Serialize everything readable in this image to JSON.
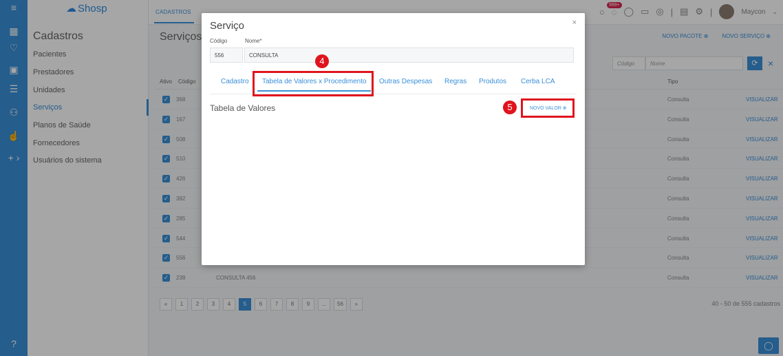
{
  "brand": {
    "name": "Shosp"
  },
  "rail_icons": [
    "menu-icon",
    "calendar-icon",
    "heart-icon",
    "camera-icon",
    "database-icon",
    "users-icon",
    "hand-icon",
    "plus-icon"
  ],
  "sidebar": {
    "title": "Cadastros",
    "items": [
      {
        "label": "Pacientes"
      },
      {
        "label": "Prestadores"
      },
      {
        "label": "Unidades"
      },
      {
        "label": "Serviços"
      },
      {
        "label": "Planos de Saúde"
      },
      {
        "label": "Fornecedores"
      },
      {
        "label": "Usuários do sistema"
      }
    ]
  },
  "header": {
    "breadcrumb": "CADASTROS",
    "notifications": "999+",
    "user": "Maycon"
  },
  "page": {
    "title": "Serviços",
    "new_package": "NOVO PACOTE ⊕",
    "new_service": "NOVO SERVIÇO ⊕",
    "filter_code_placeholder": "Código",
    "filter_name_placeholder": "Nome"
  },
  "table": {
    "headers": {
      "active": "Ativo",
      "code": "Código",
      "type": "Tipo"
    },
    "rows": [
      {
        "code": "368",
        "name": "",
        "type": "Consulta",
        "action": "VISUALIZAR"
      },
      {
        "code": "167",
        "name": "",
        "type": "Consulta",
        "action": "VISUALIZAR"
      },
      {
        "code": "508",
        "name": "",
        "type": "Consulta",
        "action": "VISUALIZAR"
      },
      {
        "code": "510",
        "name": "",
        "type": "Consulta",
        "action": "VISUALIZAR"
      },
      {
        "code": "426",
        "name": "",
        "type": "Consulta",
        "action": "VISUALIZAR"
      },
      {
        "code": "382",
        "name": "",
        "type": "Consulta",
        "action": "VISUALIZAR"
      },
      {
        "code": "285",
        "name": "",
        "type": "Consulta",
        "action": "VISUALIZAR"
      },
      {
        "code": "544",
        "name": "",
        "type": "Consulta",
        "action": "VISUALIZAR"
      },
      {
        "code": "556",
        "name": "",
        "type": "Consulta",
        "action": "VISUALIZAR"
      },
      {
        "code": "238",
        "name": "CONSULTA 456",
        "type": "Consulta",
        "action": "VISUALIZAR"
      }
    ]
  },
  "pagination": {
    "pages": [
      "«",
      "1",
      "2",
      "3",
      "4",
      "5",
      "6",
      "7",
      "8",
      "9",
      "...",
      "56",
      "»"
    ],
    "active": "5",
    "summary": "40 - 50 de 555 cadastros"
  },
  "modal": {
    "title": "Serviço",
    "close": "×",
    "code_label": "Código",
    "name_label": "Nome*",
    "code_value": "556",
    "name_value": "CONSULTA",
    "tabs": [
      {
        "label": "Cadastro"
      },
      {
        "label": "Tabela de Valores x Procedimento"
      },
      {
        "label": "Outras Despesas"
      },
      {
        "label": "Regras"
      },
      {
        "label": "Produtos"
      },
      {
        "label": "Cerba LCA"
      }
    ],
    "active_tab": "Tabela de Valores x Procedimento",
    "section_title": "Tabela de Valores",
    "new_value": "NOVO VALOR ⊕"
  },
  "annotations": {
    "step_tab": "4",
    "step_button": "5",
    "color": "#e0141e"
  },
  "colors": {
    "accent": "#3a8fd8",
    "badge": "#d9264f"
  }
}
